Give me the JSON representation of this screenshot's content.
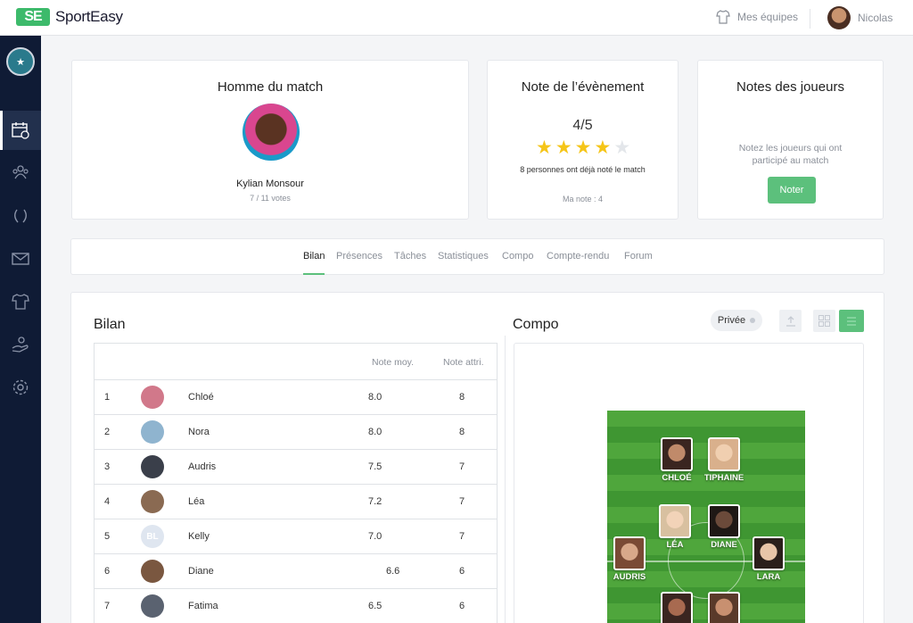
{
  "app": {
    "brand_mark": "SE",
    "brand_name": "SportEasy"
  },
  "topbar": {
    "teams_label": "Mes équipes",
    "user_name": "Nicolas"
  },
  "sidebar": {
    "items": [
      {
        "name": "calendar",
        "active": true
      },
      {
        "name": "team"
      },
      {
        "name": "trophy"
      },
      {
        "name": "messages"
      },
      {
        "name": "jersey"
      },
      {
        "name": "payments"
      },
      {
        "name": "settings"
      }
    ]
  },
  "motm": {
    "title": "Homme du match",
    "name": "Kylian Monsour",
    "votes": "7 / 11 votes"
  },
  "event_rating": {
    "title": "Note de l’évènement",
    "value": "4/5",
    "stars": 4,
    "max_stars": 5,
    "count_text": "8 personnes ont déjà noté le match",
    "my_note": "Ma note : 4"
  },
  "player_notes": {
    "title": "Notes des joueurs",
    "hint": "Notez les joueurs qui ont participé au match",
    "button": "Noter"
  },
  "tabs": [
    {
      "label": "Bilan",
      "active": true
    },
    {
      "label": "Présences"
    },
    {
      "label": "Tâches"
    },
    {
      "label": "Statistiques"
    },
    {
      "label": "Compo"
    },
    {
      "label": "Compte-rendu"
    },
    {
      "label": "Forum"
    }
  ],
  "bilan": {
    "title": "Bilan",
    "columns": {
      "avg": "Note moy.",
      "attr": "Note attri."
    },
    "rows": [
      {
        "rank": "1",
        "name": "Chloé",
        "avg": "8.0",
        "attr": "8",
        "avatar_color": "#d1788a"
      },
      {
        "rank": "2",
        "name": "Nora",
        "avg": "8.0",
        "attr": "8",
        "avatar_color": "#8fb4cf"
      },
      {
        "rank": "3",
        "name": "Audris",
        "avg": "7.5",
        "attr": "7",
        "avatar_color": "#3a3f4a"
      },
      {
        "rank": "4",
        "name": "Léa",
        "avg": "7.2",
        "attr": "7",
        "avatar_color": "#8a6a52"
      },
      {
        "rank": "5",
        "name": "Kelly",
        "avg": "7.0",
        "attr": "7",
        "initials": "BL",
        "avatar_color": "#dfe6f0"
      },
      {
        "rank": "6",
        "name": "Diane",
        "avg": "6.6",
        "attr": "6",
        "avatar_color": "#7a5740"
      },
      {
        "rank": "7",
        "name": "Fatima",
        "avg": "6.5",
        "attr": "6",
        "avatar_color": "#5a6270"
      }
    ]
  },
  "compo": {
    "title": "Compo",
    "privacy": "Privée",
    "players": [
      {
        "name": "CHLOÉ",
        "color": "#4a2e2a"
      },
      {
        "name": "TIPHAINE",
        "color": "#d9b08c"
      },
      {
        "name": "LÉA",
        "color": "#c9a27a"
      },
      {
        "name": "DIANE",
        "color": "#2e2320"
      },
      {
        "name": "AUDRIS",
        "color": "#9a6a52"
      },
      {
        "name": "LARA",
        "color": "#3b2a25"
      }
    ]
  },
  "colors": {
    "accent": "#5cc07c",
    "sidebar": "#0f1b35",
    "star": "#f5c518",
    "star_empty": "#e3e6ea"
  }
}
